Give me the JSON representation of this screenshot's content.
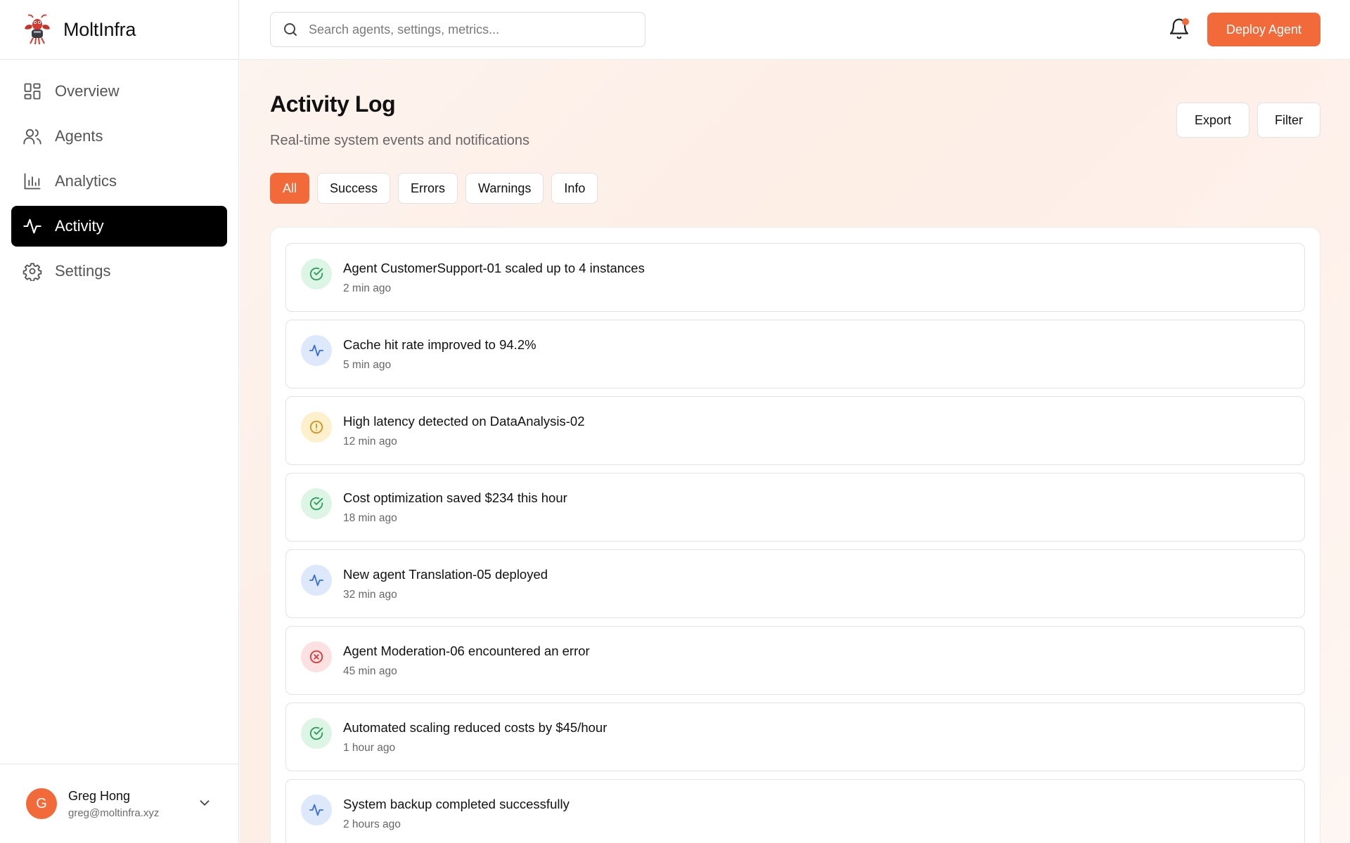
{
  "brand": {
    "name": "MoltInfra"
  },
  "sidebar": {
    "items": [
      {
        "label": "Overview",
        "icon": "grid-icon"
      },
      {
        "label": "Agents",
        "icon": "users-icon"
      },
      {
        "label": "Analytics",
        "icon": "bar-chart-icon"
      },
      {
        "label": "Activity",
        "icon": "activity-icon",
        "active": true
      },
      {
        "label": "Settings",
        "icon": "gear-icon"
      }
    ]
  },
  "user": {
    "initial": "G",
    "name": "Greg Hong",
    "email": "greg@moltinfra.xyz"
  },
  "topbar": {
    "search_placeholder": "Search agents, settings, metrics...",
    "deploy_label": "Deploy Agent"
  },
  "page": {
    "title": "Activity Log",
    "subtitle": "Real-time system events and notifications",
    "export_label": "Export",
    "filter_label": "Filter"
  },
  "filters": [
    "All",
    "Success",
    "Errors",
    "Warnings",
    "Info"
  ],
  "activity": [
    {
      "type": "success",
      "message": "Agent CustomerSupport-01 scaled up to 4 instances",
      "time": "2 min ago"
    },
    {
      "type": "info",
      "message": "Cache hit rate improved to 94.2%",
      "time": "5 min ago"
    },
    {
      "type": "warning",
      "message": "High latency detected on DataAnalysis-02",
      "time": "12 min ago"
    },
    {
      "type": "success",
      "message": "Cost optimization saved $234 this hour",
      "time": "18 min ago"
    },
    {
      "type": "info",
      "message": "New agent Translation-05 deployed",
      "time": "32 min ago"
    },
    {
      "type": "error",
      "message": "Agent Moderation-06 encountered an error",
      "time": "45 min ago"
    },
    {
      "type": "success",
      "message": "Automated scaling reduced costs by $45/hour",
      "time": "1 hour ago"
    },
    {
      "type": "info",
      "message": "System backup completed successfully",
      "time": "2 hours ago"
    }
  ],
  "colors": {
    "accent": "#f26a3a",
    "success": "#2f9e5a",
    "info": "#3b6fd8",
    "warning": "#d9921b",
    "error": "#d93a3a"
  }
}
